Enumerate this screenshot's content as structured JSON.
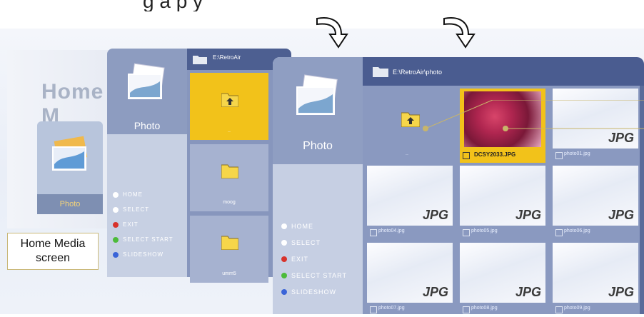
{
  "caption_top": "g a     p                                          y",
  "screens": {
    "home": {
      "title": "Home M",
      "tile_label": "Photo",
      "label": [
        "Home Media",
        "screen"
      ]
    },
    "folder": {
      "side_label": "Photo",
      "path": "E:\\RetroAir",
      "items": [
        {
          "name": "..",
          "selected": true,
          "icon": "folder-up-icon"
        },
        {
          "name": "moog",
          "selected": false,
          "icon": "folder-icon"
        },
        {
          "name": "umm5",
          "selected": false,
          "icon": "folder-icon"
        }
      ],
      "menu": [
        {
          "label": "HOME",
          "icon": "home-icon",
          "color": "#ffffff"
        },
        {
          "label": "SELECT",
          "icon": "select-icon",
          "color": "#ffffff"
        },
        {
          "label": "EXIT",
          "icon": "red-button-icon",
          "color": "#d8322b"
        },
        {
          "label": "SELECT START",
          "icon": "green-button-icon",
          "color": "#4cbb3a"
        },
        {
          "label": "SLIDESHOW",
          "icon": "blue-button-icon",
          "color": "#3a64d8"
        }
      ]
    },
    "photos": {
      "side_label": "Photo",
      "path": "E:\\RetroAir\\photo",
      "up_label": "..",
      "cells": [
        {
          "name": "DCSY2033.JPG",
          "selected": true,
          "kind": "photo"
        },
        {
          "name": "photo01.jpg",
          "selected": false,
          "kind": "jpg"
        },
        {
          "name": "photo04.jpg",
          "selected": false,
          "kind": "jpg"
        },
        {
          "name": "photo05.jpg",
          "selected": false,
          "kind": "jpg"
        },
        {
          "name": "photo06.jpg",
          "selected": false,
          "kind": "jpg"
        },
        {
          "name": "photo07.jpg",
          "selected": false,
          "kind": "jpg"
        },
        {
          "name": "photo08.jpg",
          "selected": false,
          "kind": "jpg"
        },
        {
          "name": "photo09.jpg",
          "selected": false,
          "kind": "jpg"
        }
      ],
      "jpg_badge": "JPG",
      "menu": [
        {
          "label": "HOME",
          "icon": "home-icon",
          "color": "#ffffff"
        },
        {
          "label": "SELECT",
          "icon": "select-icon",
          "color": "#ffffff"
        },
        {
          "label": "EXIT",
          "icon": "red-button-icon",
          "color": "#d8322b"
        },
        {
          "label": "SELECT START",
          "icon": "green-button-icon",
          "color": "#4cbb3a"
        },
        {
          "label": "SLIDESHOW",
          "icon": "blue-button-icon",
          "color": "#3a64d8"
        }
      ]
    }
  },
  "colors": {
    "selection": "#f2c21a",
    "pathbar": "#4a5c90",
    "panel": "#8a99c0"
  }
}
